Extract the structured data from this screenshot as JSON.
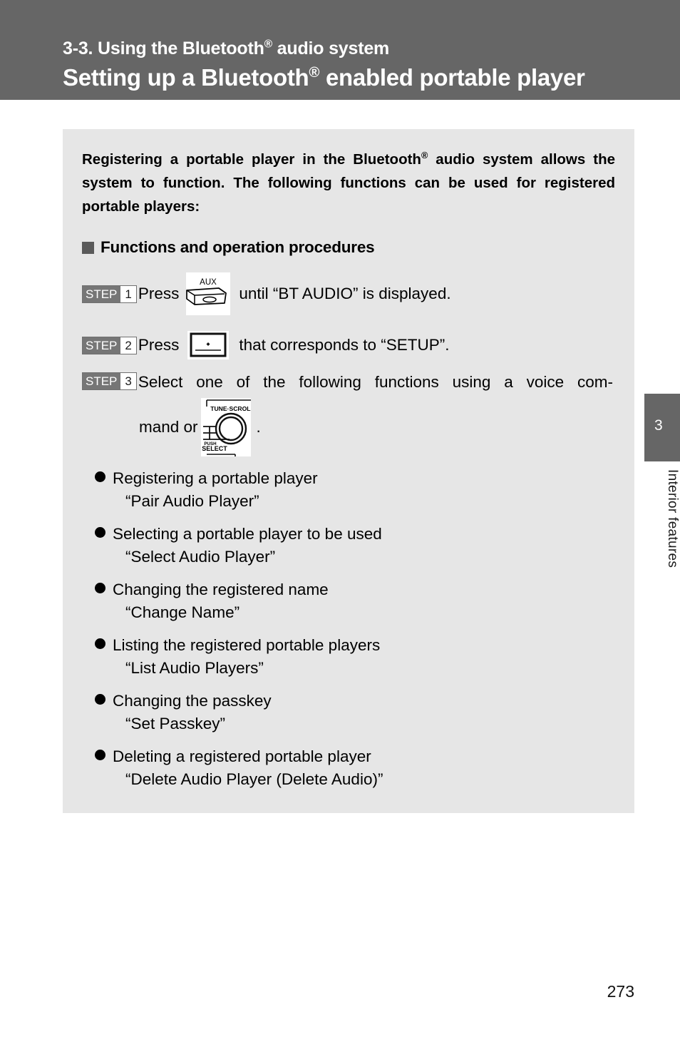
{
  "header": {
    "section_label_pre": "3-3. Using the Bluetooth",
    "section_label_reg": "®",
    "section_label_post": " audio system",
    "title_pre": "Setting up a Bluetooth",
    "title_reg": "®",
    "title_post": " enabled portable player",
    "background_color": "#666666",
    "text_color": "#ffffff"
  },
  "content": {
    "background_color": "#e6e6e6",
    "intro_pre": "Registering a portable player in the Bluetooth",
    "intro_reg": "®",
    "intro_post": " audio system allows the system to function. The following functions can be used for registered portable players:",
    "section_heading": "Functions and operation procedures",
    "steps": [
      {
        "badge_word": "STEP",
        "badge_num": "1",
        "text_before": "Press",
        "icon": "aux-button-icon",
        "icon_label": "AUX",
        "text_after": "until “BT AUDIO” is displayed."
      },
      {
        "badge_word": "STEP",
        "badge_num": "2",
        "text_before": "Press",
        "icon": "display-select-button-icon",
        "icon_label": "",
        "text_after": "that corresponds to “SETUP”."
      },
      {
        "badge_word": "STEP",
        "badge_num": "3",
        "text_line1": "Select one of the following functions using a voice com-",
        "text_line2_before": "mand or",
        "icon": "tune-scroll-knob-icon",
        "knob_label_top": "TUNE·SCROLL",
        "knob_label_push": "PUSH",
        "knob_label_select": "SELECT",
        "text_line2_after": "."
      }
    ],
    "functions": [
      {
        "description": "Registering a portable player",
        "command": "“Pair Audio Player”"
      },
      {
        "description": "Selecting a portable player to be used",
        "command": "“Select Audio Player”"
      },
      {
        "description": "Changing the registered name",
        "command": "“Change Name”"
      },
      {
        "description": "Listing the registered portable players",
        "command": "“List Audio Players”"
      },
      {
        "description": "Changing the passkey",
        "command": "“Set Passkey”"
      },
      {
        "description": "Deleting a registered portable player",
        "command": "“Delete Audio Player (Delete Audio)”"
      }
    ]
  },
  "side_tab": {
    "number": "3",
    "label": "Interior features",
    "background_color": "#666666"
  },
  "footer": {
    "page_number": "273"
  }
}
